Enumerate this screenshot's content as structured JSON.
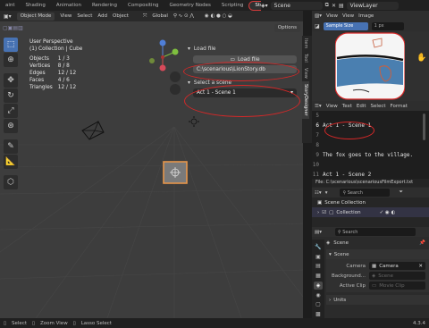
{
  "topbar": {
    "tabs": [
      "aint",
      "Shading",
      "Animation",
      "Rendering",
      "Compositing",
      "Geometry Nodes",
      "Scripting",
      "StoryDesigner"
    ],
    "scene": "Scene",
    "view_layer": "ViewLayer"
  },
  "viewport": {
    "mode": "Object Mode",
    "menus": [
      "View",
      "Select",
      "Add",
      "Object"
    ],
    "transform": "Global",
    "options": "Options",
    "stats": {
      "title": "User Perspective",
      "subtitle": "(1) Collection | Cube",
      "rows": [
        {
          "label": "Objects",
          "value": "1 / 3"
        },
        {
          "label": "Vertices",
          "value": "8 / 8"
        },
        {
          "label": "Edges",
          "value": "12 / 12"
        },
        {
          "label": "Faces",
          "value": "4 / 6"
        },
        {
          "label": "Triangles",
          "value": "12 / 12"
        }
      ]
    },
    "gizmo": {
      "z": "Z",
      "y": "Y",
      "x": "X"
    }
  },
  "npanel": {
    "load_title": "Load file",
    "load_button": "Load file",
    "file_path": "C:\\scenarious\\LionStory.db",
    "select_title": "Select a scene",
    "selected_scene": "Act 1 - Scene 1",
    "tabs": [
      "Item",
      "Tool",
      "View",
      "StoryDesigner"
    ]
  },
  "image_editor": {
    "menus": [
      "View",
      "View",
      "Image"
    ],
    "sample": "Sample Size",
    "px": "1 px"
  },
  "text_editor": {
    "menus": [
      "View",
      "Text",
      "Edit",
      "Select",
      "Format"
    ],
    "lines": [
      {
        "num": "5",
        "text": ""
      },
      {
        "num": "6",
        "text": "Act 1 - Scene 1"
      },
      {
        "num": "7",
        "text": ""
      },
      {
        "num": "8",
        "text": ""
      },
      {
        "num": "9",
        "text": "The fox goes to the village."
      },
      {
        "num": "10",
        "text": ""
      },
      {
        "num": "11",
        "text": "Act 1 - Scene 2"
      }
    ],
    "file": "File: C:\\scenarious\\scenariousFilmExport.txt"
  },
  "outliner": {
    "search_placeholder": "Search",
    "scene_collection": "Scene Collection",
    "collection": "Collection"
  },
  "properties": {
    "search_placeholder": "Search",
    "title": "Scene",
    "section": "Scene",
    "camera_label": "Camera",
    "camera_value": "Camera",
    "background_label": "Background...",
    "background_value": "Scene",
    "clip_label": "Active Clip",
    "clip_value": "Movie Clip",
    "units": "Units"
  },
  "statusbar": {
    "items": [
      "Select",
      "Zoom View",
      "Lasso Select"
    ],
    "version": "4.3.4"
  },
  "colors": {
    "accent": "#4772b3",
    "highlight": "#d62828",
    "cube": "#e6954a"
  }
}
